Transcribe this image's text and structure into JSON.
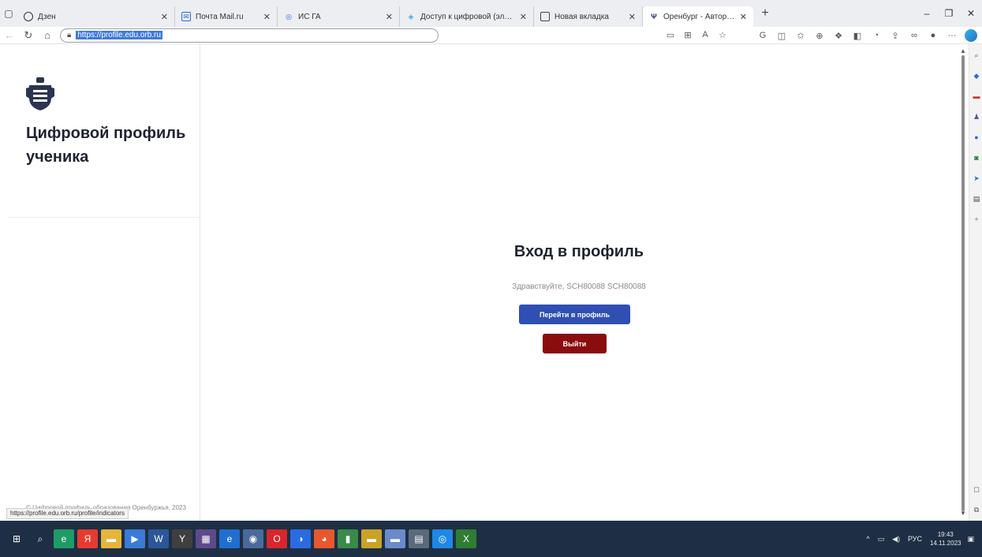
{
  "browser": {
    "tabs": [
      {
        "title": "Дзен",
        "active": false
      },
      {
        "title": "Почта Mail.ru",
        "active": false
      },
      {
        "title": "ИС ГА",
        "active": false
      },
      {
        "title": "Доступ к цифровой (электрон...",
        "active": false
      },
      {
        "title": "Новая вкладка",
        "active": false
      },
      {
        "title": "Оренбург - Авторизация",
        "active": true
      }
    ],
    "address_url": "https://profile.edu.orb.ru",
    "status_link": "https://profile.edu.orb.ru/profile/indicators"
  },
  "sidebar": {
    "brand_title": "Цифровой профиль ученика",
    "copyright": "© Цифровой профиль образования Оренбуржья, 2023"
  },
  "login": {
    "title": "Вход в профиль",
    "greeting": "Здравствуйте, SCH80088 SCH80088",
    "go_profile_label": "Перейти в профиль",
    "logout_label": "Выйти"
  },
  "taskbar": {
    "language": "РУС",
    "time": "19:43",
    "date": "14.11.2023"
  },
  "colors": {
    "primary_button": "#2f4fb3",
    "logout_button": "#8a0c0c"
  }
}
